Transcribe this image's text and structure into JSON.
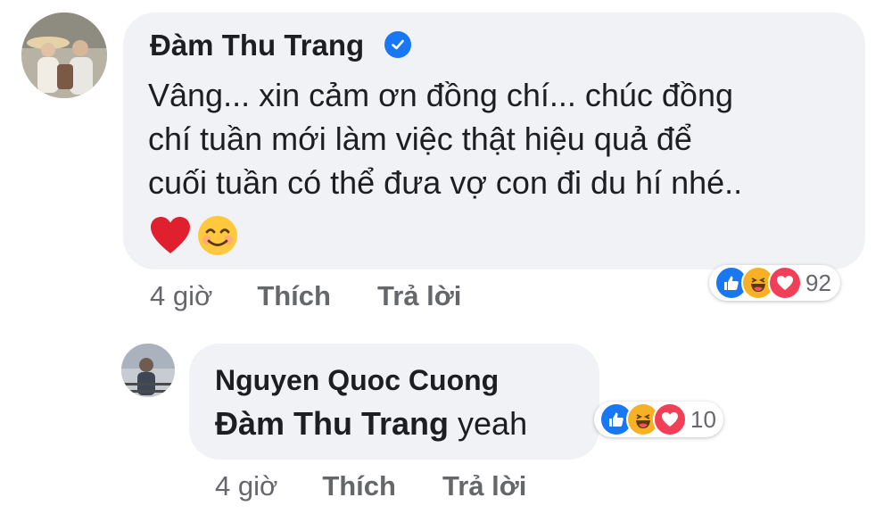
{
  "comment": {
    "author": "Đàm Thu Trang",
    "verified_icon": "verified-badge-icon",
    "text_lines": [
      "Vâng... xin cảm ơn đồng chí... chúc đồng",
      "chí tuần mới làm việc thật hiệu quả để",
      "cuối tuần có thể đưa vợ con đi du hí nhé.."
    ],
    "emojis": [
      "red-heart-icon",
      "smiling-face-icon"
    ],
    "time": "4 giờ",
    "like_label": "Thích",
    "reply_label": "Trả lời",
    "reactions": {
      "icons": [
        "like-icon",
        "haha-icon",
        "love-icon"
      ],
      "count": "92"
    }
  },
  "reply": {
    "author": "Nguyen Quoc Cuong",
    "mention": "Đàm Thu Trang",
    "text": " yeah",
    "time": "4 giờ",
    "like_label": "Thích",
    "reply_label": "Trả lời",
    "reactions": {
      "icons": [
        "like-icon",
        "haha-icon",
        "love-icon"
      ],
      "count": "10"
    }
  },
  "colors": {
    "bubble": "#f0f2f5",
    "secondary_text": "#65676b",
    "like_blue": "#1877f2",
    "love_red": "#f33e58",
    "haha_yellow": "#f7b125"
  }
}
